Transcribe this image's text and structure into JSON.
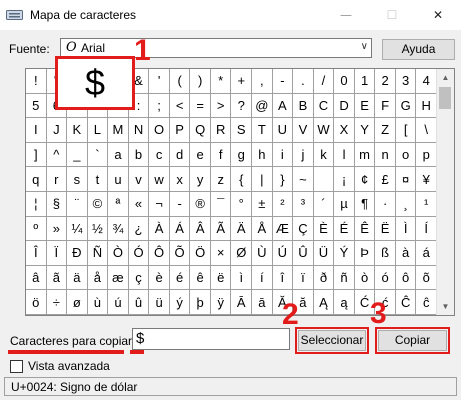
{
  "window": {
    "title": "Mapa de caracteres",
    "min_symbol": "—",
    "max_symbol": "☐",
    "close_symbol": "✕"
  },
  "font": {
    "label": "Fuente:",
    "icon_glyph": "O",
    "value": "Arial",
    "dropdown_glyph": "∨"
  },
  "help_button": "Ayuda",
  "selected_char": "$",
  "grid": [
    [
      "!",
      "\"",
      "#",
      "$",
      "%",
      "&",
      "'",
      "(",
      ")",
      "*",
      "+",
      ",",
      "-",
      ".",
      "/",
      "0",
      "1",
      "2",
      "3",
      "4"
    ],
    [
      "5",
      "6",
      "7",
      "8",
      "9",
      ":",
      ";",
      "<",
      "=",
      ">",
      "?",
      "@",
      "A",
      "B",
      "C",
      "D",
      "E",
      "F",
      "G",
      "H"
    ],
    [
      "I",
      "J",
      "K",
      "L",
      "M",
      "N",
      "O",
      "P",
      "Q",
      "R",
      "S",
      "T",
      "U",
      "V",
      "W",
      "X",
      "Y",
      "Z",
      "[",
      "\\"
    ],
    [
      "]",
      "^",
      "_",
      "`",
      "a",
      "b",
      "c",
      "d",
      "e",
      "f",
      "g",
      "h",
      "i",
      "j",
      "k",
      "l",
      "m",
      "n",
      "o",
      "p"
    ],
    [
      "q",
      "r",
      "s",
      "t",
      "u",
      "v",
      "w",
      "x",
      "y",
      "z",
      "{",
      "|",
      "}",
      "~",
      " ",
      "¡",
      "¢",
      "£",
      "¤",
      "¥"
    ],
    [
      "¦",
      "§",
      "¨",
      "©",
      "ª",
      "«",
      "¬",
      "-",
      "®",
      "¯",
      "°",
      "±",
      "²",
      "³",
      "´",
      "µ",
      "¶",
      "·",
      "¸",
      "¹"
    ],
    [
      "º",
      "»",
      "¼",
      "½",
      "¾",
      "¿",
      "À",
      "Á",
      "Â",
      "Ã",
      "Ä",
      "Å",
      "Æ",
      "Ç",
      "È",
      "É",
      "Ê",
      "Ë",
      "Ì",
      "Í"
    ],
    [
      "Î",
      "Ï",
      "Ð",
      "Ñ",
      "Ò",
      "Ó",
      "Ô",
      "Õ",
      "Ö",
      "×",
      "Ø",
      "Ù",
      "Ú",
      "Û",
      "Ü",
      "Ý",
      "Þ",
      "ß",
      "à",
      "á"
    ],
    [
      "â",
      "ã",
      "ä",
      "å",
      "æ",
      "ç",
      "è",
      "é",
      "ê",
      "ë",
      "ì",
      "í",
      "î",
      "ï",
      "ð",
      "ñ",
      "ò",
      "ó",
      "ô",
      "õ"
    ],
    [
      "ö",
      "÷",
      "ø",
      "ù",
      "ú",
      "û",
      "ü",
      "ý",
      "þ",
      "ÿ",
      "Ā",
      "ā",
      "Ă",
      "ă",
      "Ą",
      "ą",
      "Ć",
      "ć",
      "Ĉ",
      "ĉ"
    ]
  ],
  "scrollbar": {
    "up": "▲",
    "down": "▼"
  },
  "steps": [
    "1",
    "2",
    "3"
  ],
  "copy": {
    "label": "Caracteres para copiar:",
    "value": "$",
    "select_button": "Seleccionar",
    "copy_button": "Copiar"
  },
  "advanced": {
    "label": "Vista avanzada",
    "checked": false
  },
  "status": "U+0024: Signo de dólar",
  "colors": {
    "annotation": "#e21b1b",
    "window_bg": "#f0f0f0"
  }
}
